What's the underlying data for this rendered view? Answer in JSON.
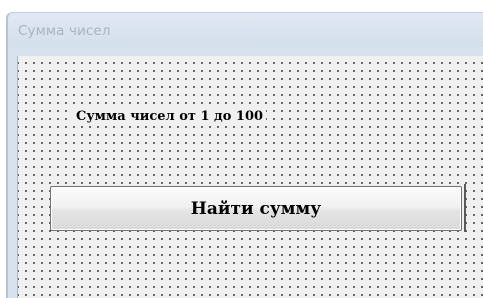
{
  "window": {
    "title": "Сумма чисел"
  },
  "form": {
    "label_text": "Сумма чисел от 1 до 100",
    "button_label": "Найти сумму"
  }
}
